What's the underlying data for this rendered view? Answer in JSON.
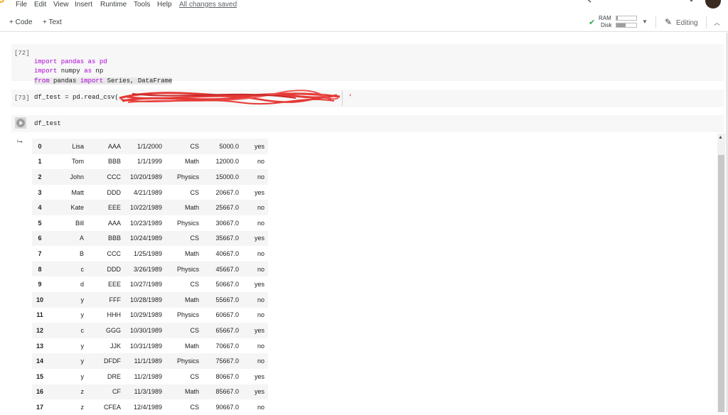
{
  "menu": {
    "items": [
      "File",
      "Edit",
      "View",
      "Insert",
      "Runtime",
      "Tools",
      "Help"
    ],
    "status": "All changes saved"
  },
  "toolbar": {
    "add_code": "+ Code",
    "add_text": "+ Text",
    "ram_label": "RAM",
    "disk_label": "Disk",
    "ram_usage": 0.08,
    "disk_usage": 0.45,
    "mode": "Editing",
    "status_color": "#34a853",
    "icons": [
      "check-icon",
      "chevron-down-icon",
      "pencil-icon",
      "chevron-up-icon"
    ]
  },
  "cells": [
    {
      "prompt": "[72]",
      "lines": [
        "import pandas as pd",
        "import numpy as np",
        "from pandas import Series, DataFrame"
      ]
    },
    {
      "prompt": "[73]",
      "code": "df_test = pd.read_csv(",
      "code_tail": "'"
    },
    {
      "prompt": "",
      "code": "df_test"
    }
  ],
  "output": {
    "rows": [
      [
        "0",
        "Lisa",
        "AAA",
        "1/1/2000",
        "CS",
        "5000.0",
        "yes"
      ],
      [
        "1",
        "Tom",
        "BBB",
        "1/1/1999",
        "Math",
        "12000.0",
        "no"
      ],
      [
        "2",
        "John",
        "CCC",
        "10/20/1989",
        "Physics",
        "15000.0",
        "no"
      ],
      [
        "3",
        "Matt",
        "DDD",
        "4/21/1989",
        "CS",
        "20667.0",
        "yes"
      ],
      [
        "4",
        "Kate",
        "EEE",
        "10/22/1989",
        "Math",
        "25667.0",
        "no"
      ],
      [
        "5",
        "Bill",
        "AAA",
        "10/23/1989",
        "Physics",
        "30667.0",
        "no"
      ],
      [
        "6",
        "A",
        "BBB",
        "10/24/1989",
        "CS",
        "35667.0",
        "yes"
      ],
      [
        "7",
        "B",
        "CCC",
        "1/25/1989",
        "Math",
        "40667.0",
        "no"
      ],
      [
        "8",
        "c",
        "DDD",
        "3/26/1989",
        "Physics",
        "45667.0",
        "no"
      ],
      [
        "9",
        "d",
        "EEE",
        "10/27/1989",
        "CS",
        "50667.0",
        "yes"
      ],
      [
        "10",
        "y",
        "FFF",
        "10/28/1989",
        "Math",
        "55667.0",
        "no"
      ],
      [
        "11",
        "y",
        "HHH",
        "10/29/1989",
        "Physics",
        "60667.0",
        "no"
      ],
      [
        "12",
        "c",
        "GGG",
        "10/30/1989",
        "CS",
        "65667.0",
        "yes"
      ],
      [
        "13",
        "y",
        "JJK",
        "10/31/1989",
        "Math",
        "70667.0",
        "no"
      ],
      [
        "14",
        "y",
        "DFDF",
        "11/1/1989",
        "Physics",
        "75667.0",
        "no"
      ],
      [
        "15",
        "y",
        "DRE",
        "11/2/1989",
        "CS",
        "80667.0",
        "yes"
      ],
      [
        "16",
        "z",
        "CF",
        "11/3/1989",
        "Math",
        "85667.0",
        "yes"
      ],
      [
        "17",
        "z",
        "CFEA",
        "12/4/1989",
        "CS",
        "90667.0",
        "no"
      ]
    ]
  }
}
